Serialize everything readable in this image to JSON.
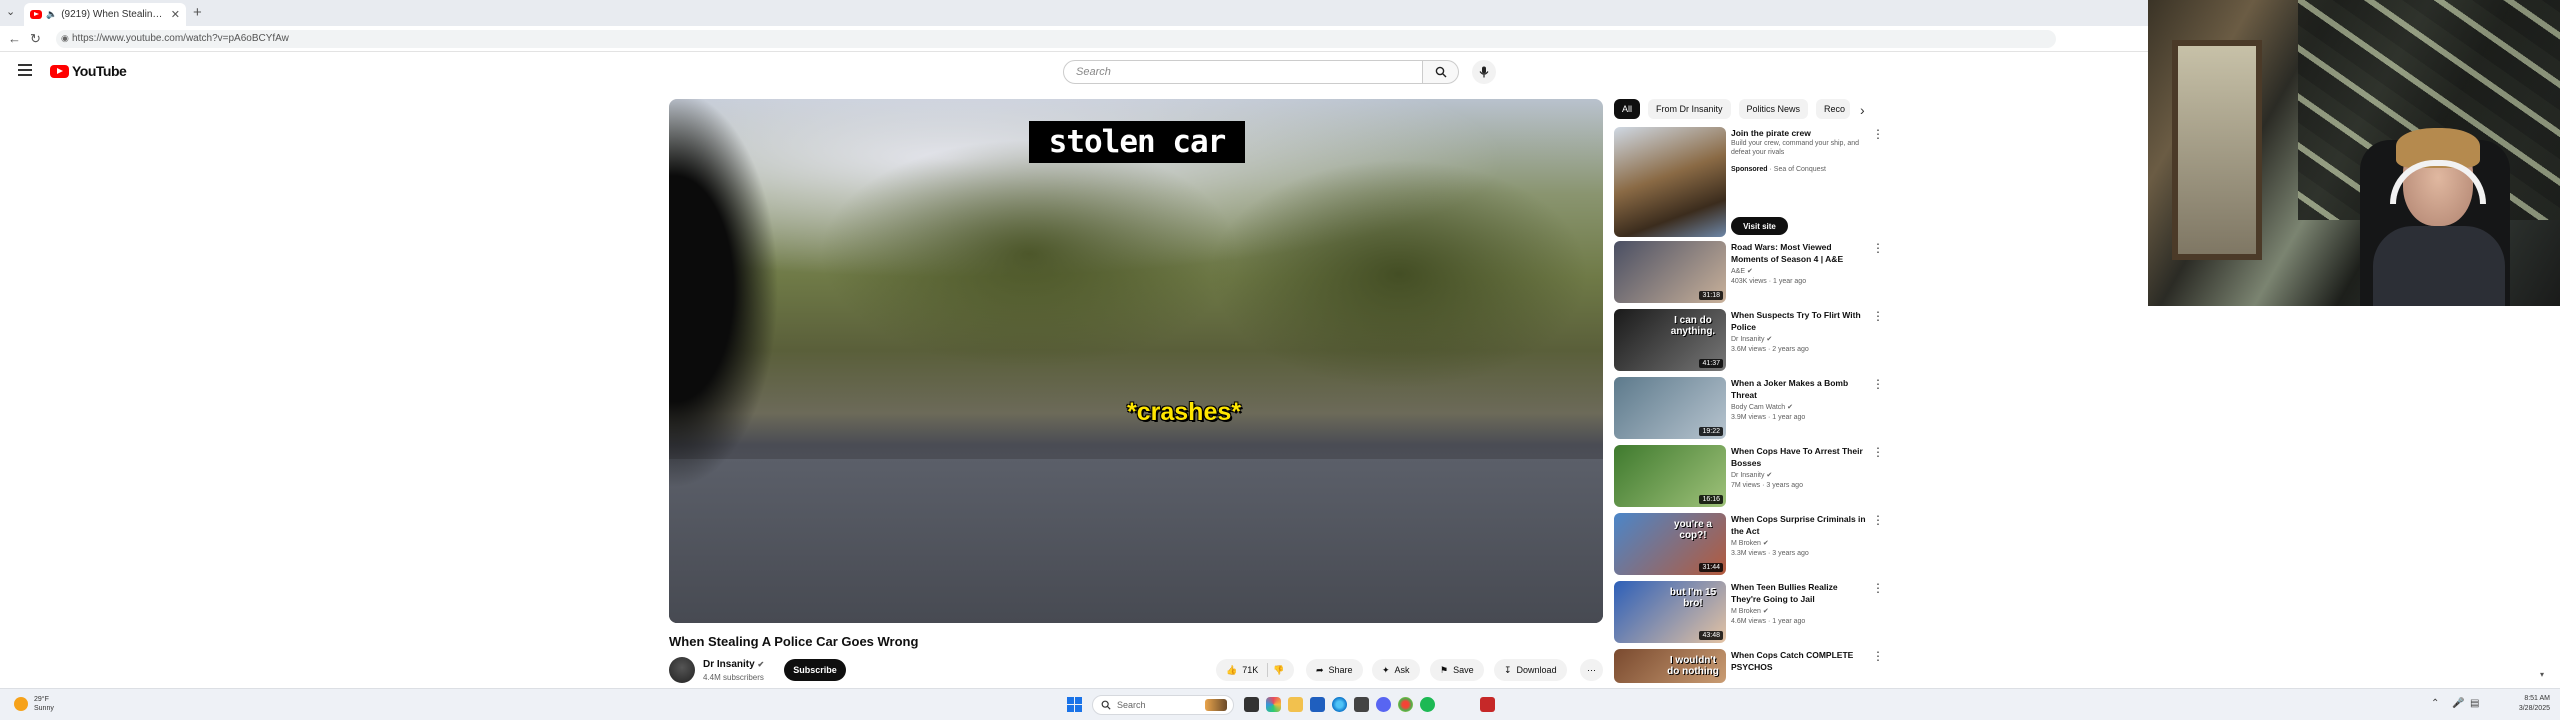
{
  "browser": {
    "tab_title": "(9219) When Stealing A Police...",
    "url": "https://www.youtube.com/watch?v=pA6oBCYfAw"
  },
  "youtube": {
    "logo_text": "YouTube",
    "search_placeholder": "Search"
  },
  "player": {
    "caption_top": "stolen car",
    "caption_sfx": "*crashes*"
  },
  "video": {
    "title": "When Stealing A Police Car Goes Wrong",
    "channel": "Dr Insanity",
    "subscribers": "4.4M subscribers",
    "subscribe_label": "Subscribe",
    "likes": "71K",
    "share_label": "Share",
    "ask_label": "Ask",
    "save_label": "Save",
    "download_label": "Download"
  },
  "sidebar": {
    "chips": [
      "All",
      "From Dr Insanity",
      "Politics News",
      "Reco"
    ],
    "ad": {
      "title": "Join the pirate crew",
      "text": "Build your crew, command your ship, and defeat your rivals",
      "sponsored": "Sponsored",
      "advertiser": "Sea of Conquest",
      "cta": "Visit site"
    },
    "videos": [
      {
        "title": "Road Wars: Most Viewed Moments of Season 4 | A&E",
        "channel": "A&E",
        "meta": "403K views · 1 year ago",
        "duration": "31:18",
        "thumb_a": "#4a4f63",
        "thumb_b": "#c9b19a"
      },
      {
        "title": "When Suspects Try To Flirt With Police",
        "channel": "Dr Insanity",
        "meta": "3.6M views · 2 years ago",
        "duration": "41:37",
        "thumb_a": "#1a1a1a",
        "thumb_b": "#777777",
        "overlay": "I can do anything."
      },
      {
        "title": "When a Joker Makes a Bomb Threat",
        "channel": "Body Cam Watch",
        "meta": "3.9M views · 1 year ago",
        "duration": "19:22",
        "thumb_a": "#5d7a8c",
        "thumb_b": "#b7c4cf"
      },
      {
        "title": "When Cops Have To Arrest Their Bosses",
        "channel": "Dr Insanity",
        "meta": "7M views · 3 years ago",
        "duration": "16:16",
        "thumb_a": "#3f7a2e",
        "thumb_b": "#9fc27a"
      },
      {
        "title": "When Cops Surprise Criminals in the Act",
        "channel": "M Broken",
        "meta": "3.3M views · 3 years ago",
        "duration": "31:44",
        "thumb_a": "#4b86c9",
        "thumb_b": "#b45a3c",
        "overlay": "you're a cop?!"
      },
      {
        "title": "When Teen Bullies Realize They're Going to Jail",
        "channel": "M Broken",
        "meta": "4.6M views · 1 year ago",
        "duration": "43:48",
        "thumb_a": "#2d5fb8",
        "thumb_b": "#e4c3a3",
        "overlay": "but I'm 15 bro!"
      },
      {
        "title": "When Cops Catch COMPLETE PSYCHOS",
        "channel": "",
        "meta": "",
        "duration": "",
        "thumb_a": "#7a4a2f",
        "thumb_b": "#c99c73",
        "overlay": "I wouldn't do nothing"
      }
    ]
  },
  "taskbar": {
    "weather_temp": "29°F",
    "weather_desc": "Sunny",
    "search_placeholder": "Search",
    "time": "8:51 AM",
    "date": "3/28/2025"
  },
  "colors": {
    "accent": "#ff0000",
    "caption_yellow": "#ffe600"
  }
}
